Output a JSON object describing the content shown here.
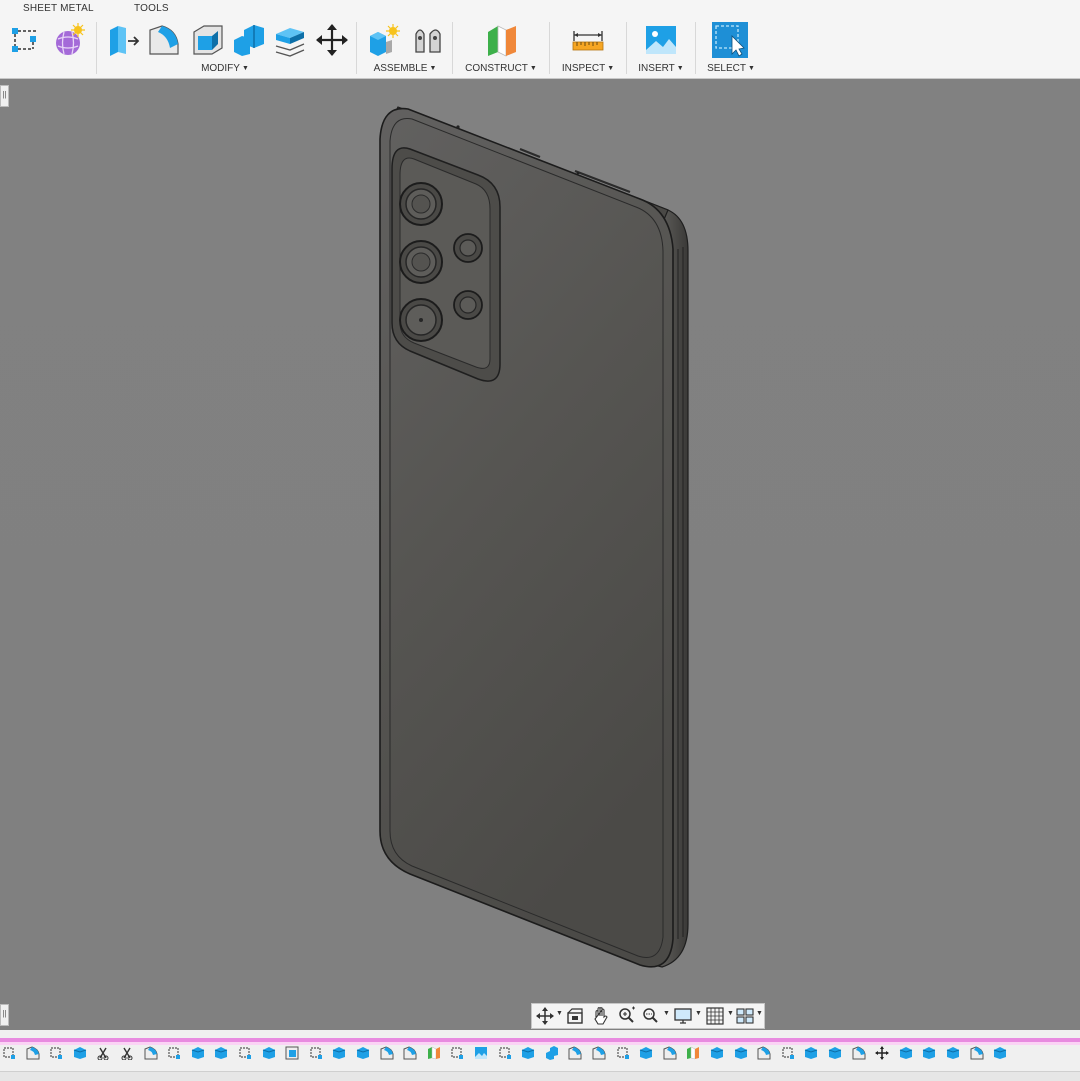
{
  "toolbar": {
    "tabs": [
      "SHEET METAL",
      "TOOLS"
    ],
    "groups": {
      "modify": "MODIFY",
      "assemble": "ASSEMBLE",
      "construct": "CONSTRUCT",
      "inspect": "INSPECT",
      "insert": "INSERT",
      "select": "SELECT"
    },
    "caret": "▼"
  },
  "colors": {
    "accent_blue": "#1ea0e6",
    "viewport_bg": "#808080",
    "timeline_marker": "#e88be0",
    "model_body": "#575550"
  },
  "icons": {
    "toolbar": [
      "sketch-dimension-icon",
      "form-icon",
      "press-pull-icon",
      "fillet-icon",
      "shell-icon",
      "combine-icon",
      "offset-face-icon",
      "move-icon",
      "new-component-icon",
      "joint-icon",
      "offset-plane-icon",
      "measure-icon",
      "insert-canvas-icon",
      "select-icon"
    ],
    "navbar": [
      "orbit-icon",
      "look-at-icon",
      "pan-icon",
      "zoom-icon",
      "fit-icon",
      "display-settings-icon",
      "grid-icon",
      "viewports-icon"
    ]
  }
}
